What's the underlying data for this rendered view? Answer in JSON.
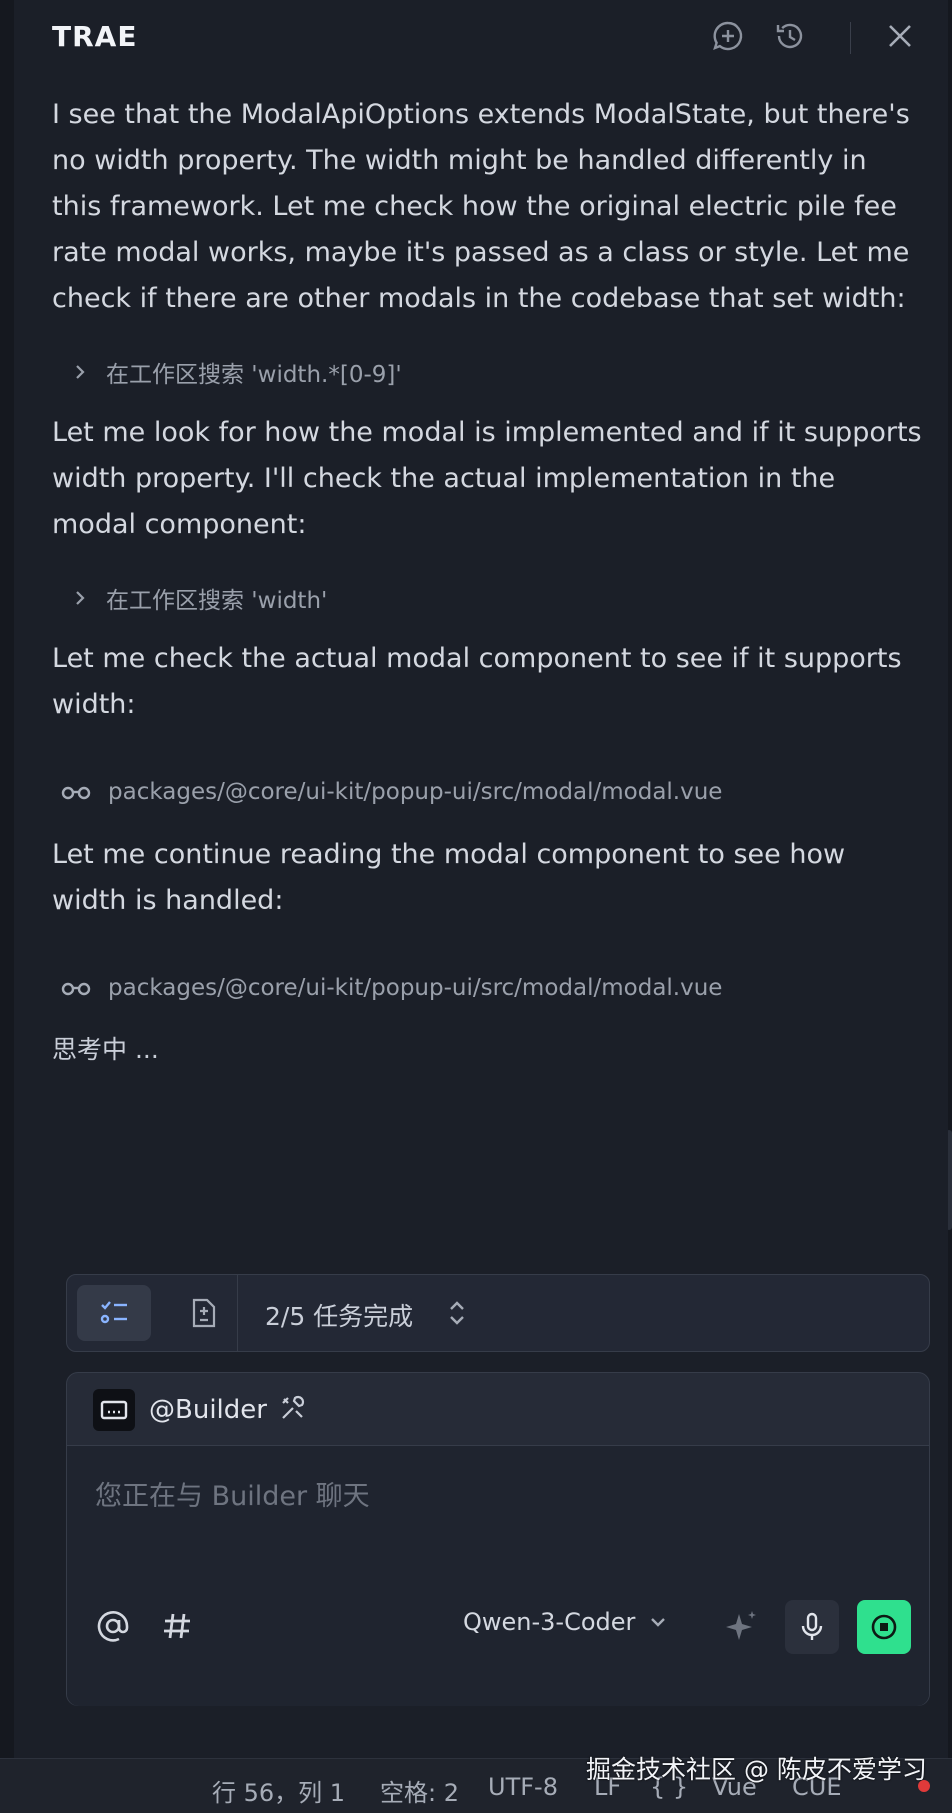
{
  "header": {
    "title": "TRAE",
    "icons": [
      "new-chat-icon",
      "history-icon",
      "close-icon"
    ]
  },
  "messages": {
    "p1": "I see that the ModalApiOptions extends ModalState, but there's no width property. The width might be handled differently in this framework. Let me check how the original electric pile fee rate modal works, maybe it's passed as a class or style. Let me check if there are other modals in the codebase that set width:",
    "tool1": "在工作区搜索 'width.*[0-9]'",
    "p2": "Let me look for how the modal is implemented and if it supports width property. I'll check the actual implementation in the modal component:",
    "tool2": "在工作区搜索 'width'",
    "p3": "Let me check the actual modal component to see if it supports width:",
    "file1": "packages/@core/ui-kit/popup-ui/src/modal/modal.vue",
    "p4": "Let me continue reading the modal component to see how width is handled:",
    "file2": "packages/@core/ui-kit/popup-ui/src/modal/modal.vue",
    "thinking": "思考中 ..."
  },
  "tasks": {
    "progress_text": "2/5 任务完成",
    "done": 2,
    "total": 5
  },
  "chat": {
    "agent": "@Builder",
    "placeholder": "您正在与 Builder 聊天",
    "model": "Qwen-3-Coder",
    "accent": "#2fe08e"
  },
  "status_bar": {
    "position": "行 56，列 1",
    "spaces": "空格: 2",
    "encoding": "UTF-8",
    "eol": "LF",
    "language": "Vue",
    "cue": "CUE"
  },
  "watermark": "掘金技术社区 @ 陈皮不爱学习"
}
